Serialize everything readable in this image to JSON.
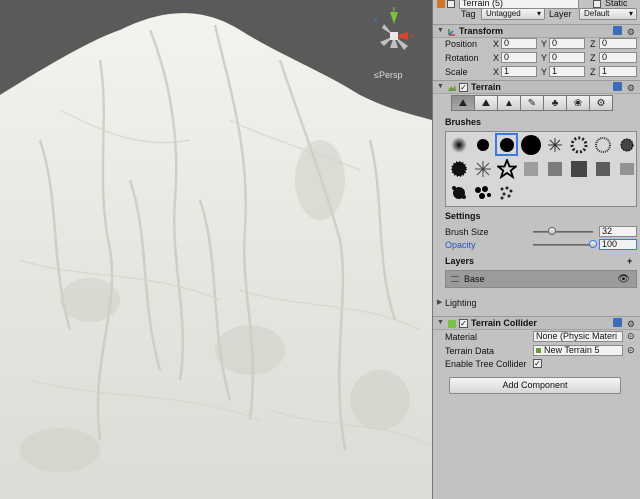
{
  "scene": {
    "projection_label": "≤Persp",
    "gizmo_axes": {
      "y": "y",
      "x": "x",
      "z": "z"
    }
  },
  "inspector": {
    "top": {
      "object_name_partial": "Terrain (5)",
      "static_label": "Static",
      "tag_label": "Tag",
      "tag_value": "Untagged",
      "layer_label": "Layer",
      "layer_value": "Default"
    },
    "transform": {
      "title": "Transform",
      "rows": [
        {
          "label": "Position",
          "x": "0",
          "y": "0",
          "z": "0"
        },
        {
          "label": "Rotation",
          "x": "0",
          "y": "0",
          "z": "0"
        },
        {
          "label": "Scale",
          "x": "1",
          "y": "1",
          "z": "1"
        }
      ],
      "axis_x": "X",
      "axis_y": "Y",
      "axis_z": "Z"
    },
    "terrain": {
      "title": "Terrain",
      "tools": [
        "raise-lower-icon",
        "paint-height-icon",
        "smooth-height-icon",
        "paint-texture-icon",
        "place-trees-icon",
        "paint-details-icon",
        "settings-icon"
      ],
      "brushes_label": "Brushes",
      "brush_count": 24,
      "selected_brush": 2,
      "settings_label": "Settings",
      "brush_size_label": "Brush Size",
      "brush_size_value": "32",
      "brush_size_level": 0.32,
      "opacity_label": "Opacity",
      "opacity_value": "100",
      "opacity_level": 1.0,
      "layers_label": "Layers",
      "layers_add": "+",
      "layer_name": "Base",
      "lighting_label": "Lighting"
    },
    "collider": {
      "title": "Terrain Collider",
      "material_label": "Material",
      "material_value": "None (Physic Materi",
      "terrain_data_label": "Terrain Data",
      "terrain_data_value": "New Terrain 5",
      "tree_collider_label": "Enable Tree Collider",
      "tree_collider_checked": "✓"
    },
    "add_component_label": "Add Component"
  },
  "colors": {
    "accent": "#3b7ae0",
    "inspector_bg": "#c2c2c2",
    "terrain_white": "#ebebe6"
  }
}
